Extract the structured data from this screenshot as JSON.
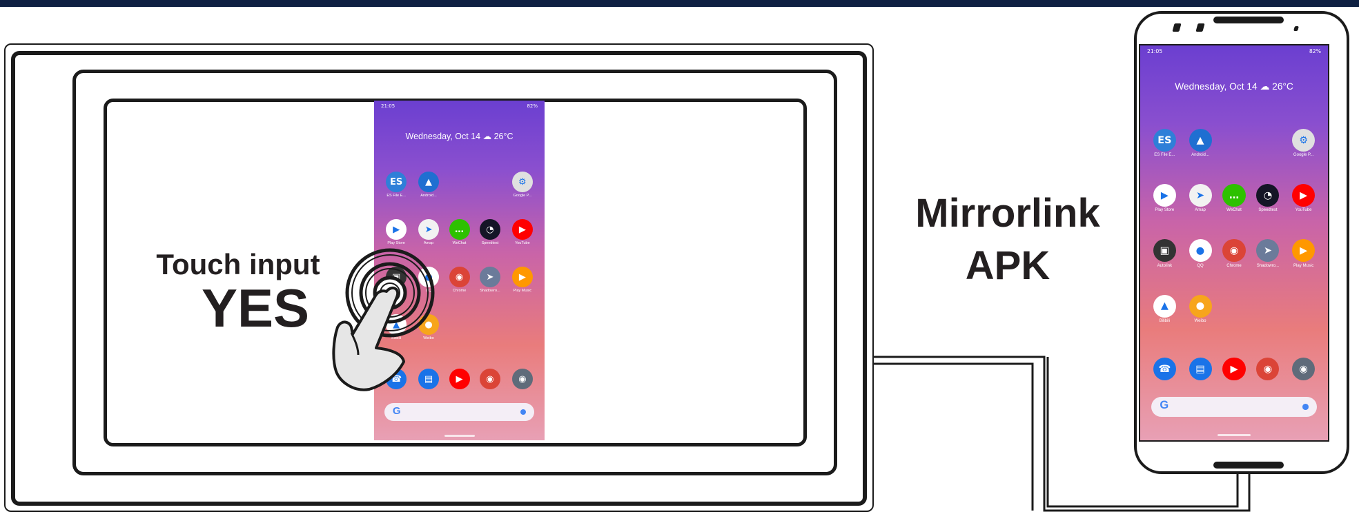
{
  "touch": {
    "label": "Touch input",
    "value": "YES"
  },
  "mirrorlink": {
    "line1": "Mirrorlink",
    "line2": "APK"
  },
  "android": {
    "time": "21:05",
    "battery": "82%",
    "date": "Wednesday, Oct 14 ☁ 26°C",
    "apps": [
      {
        "name": "es-file-explorer-icon",
        "label": "ES File E...",
        "color": "#2f7fd8",
        "glyph": "ES"
      },
      {
        "name": "android-auto-icon",
        "label": "Android...",
        "color": "#1f6fd1",
        "glyph": "▲"
      },
      {
        "name": "google-play-services-icon",
        "label": "Google P...",
        "color": "#e0e0e0",
        "glyph": "⚙"
      },
      {
        "name": "play-store-icon",
        "label": "Play Store",
        "color": "#ffffff",
        "glyph": "▶"
      },
      {
        "name": "amap-icon",
        "label": "Amap",
        "color": "#f2f2f2",
        "glyph": "➤"
      },
      {
        "name": "wechat-icon",
        "label": "WeChat",
        "color": "#2dc100",
        "glyph": "…"
      },
      {
        "name": "speedtest-icon",
        "label": "Speedtest",
        "color": "#141526",
        "glyph": "◔"
      },
      {
        "name": "youtube-icon",
        "label": "YouTube",
        "color": "#ff0000",
        "glyph": "▶"
      },
      {
        "name": "autolink-icon",
        "label": "Autolink",
        "color": "#333333",
        "glyph": "▣"
      },
      {
        "name": "qq-icon",
        "label": "QQ",
        "color": "#ffffff",
        "glyph": "●"
      },
      {
        "name": "chrome-icon",
        "label": "Chrome",
        "color": "#db4437",
        "glyph": "◉"
      },
      {
        "name": "telegram-icon",
        "label": "Shadowro...",
        "color": "#6b7b9a",
        "glyph": "➤"
      },
      {
        "name": "play-music-icon",
        "label": "Play Music",
        "color": "#ff9800",
        "glyph": "▶"
      },
      {
        "name": "bilibili-icon",
        "label": "Bilibili",
        "color": "#ffffff",
        "glyph": "▲"
      },
      {
        "name": "weibo-icon",
        "label": "Weibo",
        "color": "#f7a51c",
        "glyph": "●"
      }
    ],
    "dock": [
      {
        "name": "phone-icon",
        "color": "#1a73e8",
        "glyph": "☎"
      },
      {
        "name": "messages-icon",
        "color": "#1a73e8",
        "glyph": "▤"
      },
      {
        "name": "youtube-dock-icon",
        "color": "#ff0000",
        "glyph": "▶"
      },
      {
        "name": "chrome-dock-icon",
        "color": "#db4437",
        "glyph": "◉"
      },
      {
        "name": "camera-icon",
        "color": "#5f6b7a",
        "glyph": "◉"
      }
    ],
    "search_glyph": "G"
  },
  "colors": {
    "top_bar": "#0f2143",
    "line": "#1b1b1b"
  }
}
